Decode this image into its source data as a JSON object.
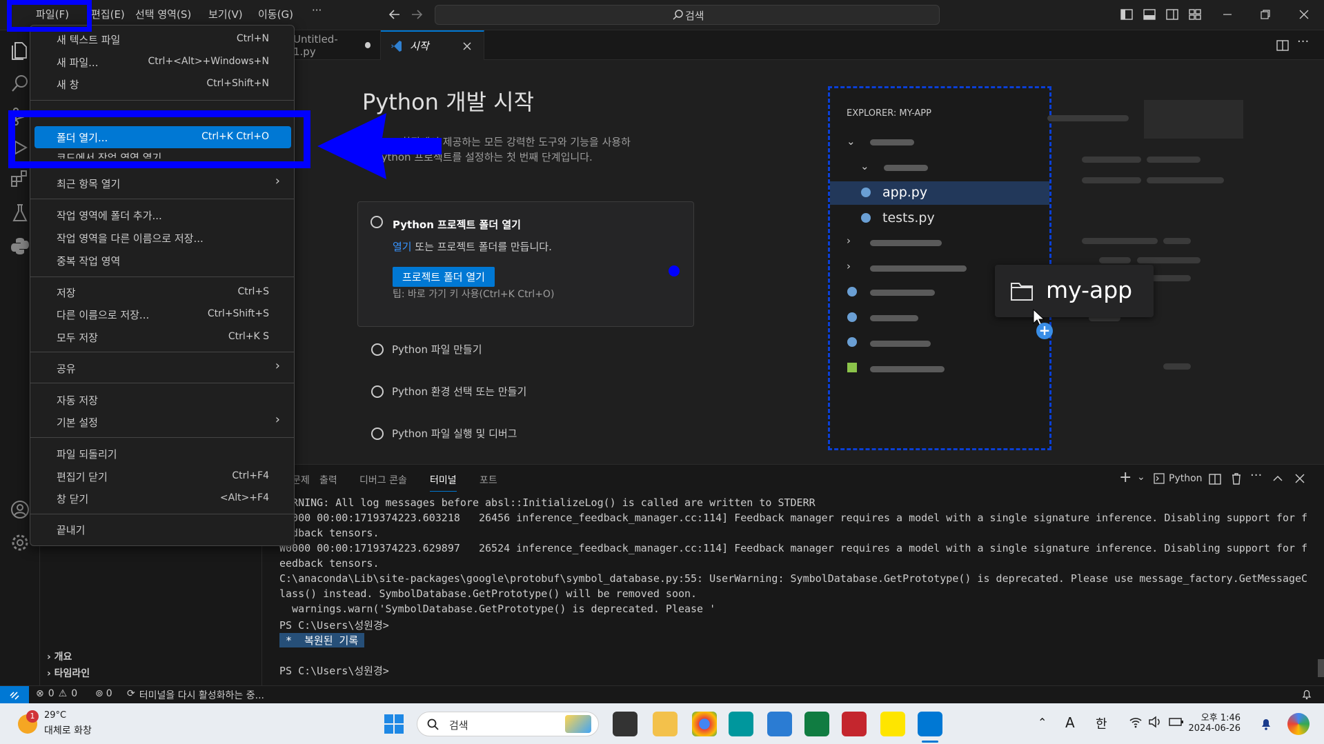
{
  "titlebar": {
    "menus": [
      "파일(F)",
      "편집(E)",
      "선택 영역(S)",
      "보기(V)",
      "이동(G)",
      "···"
    ],
    "search_placeholder": "검색"
  },
  "file_menu": {
    "items": [
      {
        "label": "새 텍스트 파일",
        "shortcut": "Ctrl+N"
      },
      {
        "label": "새 파일...",
        "shortcut": "Ctrl+<Alt>+Windows+N"
      },
      {
        "label": "새 창",
        "shortcut": "Ctrl+Shift+N"
      },
      {
        "label": "폴더 열기...",
        "shortcut": "Ctrl+K Ctrl+O"
      },
      {
        "label": "코드에서 작업 영역 열기...",
        "shortcut": ""
      },
      {
        "label": "최근 항목 열기",
        "shortcut": ""
      },
      {
        "label": "작업 영역에 폴더 추가...",
        "shortcut": ""
      },
      {
        "label": "작업 영역을 다른 이름으로 저장...",
        "shortcut": ""
      },
      {
        "label": "중복 작업 영역",
        "shortcut": ""
      },
      {
        "label": "저장",
        "shortcut": "Ctrl+S"
      },
      {
        "label": "다른 이름으로 저장...",
        "shortcut": "Ctrl+Shift+S"
      },
      {
        "label": "모두 저장",
        "shortcut": "Ctrl+K S"
      },
      {
        "label": "공유",
        "shortcut": ""
      },
      {
        "label": "자동 저장",
        "shortcut": ""
      },
      {
        "label": "기본 설정",
        "shortcut": ""
      },
      {
        "label": "파일 되돌리기",
        "shortcut": ""
      },
      {
        "label": "편집기 닫기",
        "shortcut": "Ctrl+F4"
      },
      {
        "label": "창 닫기",
        "shortcut": "<Alt>+F4"
      },
      {
        "label": "끝내기",
        "shortcut": ""
      }
    ]
  },
  "tabs": [
    {
      "label": "Untitled-1.py"
    },
    {
      "label": "시작"
    }
  ],
  "welcome": {
    "title": "Python 개발 시작",
    "desc_line1": "Python 확장에서 제공하는 모든 강력한 도구와 기능을 사용하",
    "desc_line2": "여 Python 프로젝트를 설정하는 첫 번째 단계입니다.",
    "step1_title": "Python 프로젝트 폴더 열기",
    "step1_link": "열기",
    "step1_desc": " 또는 프로젝트 폴더를 만듭니다.",
    "step1_button": "프로젝트 폴더 열기",
    "step1_tip": "팁: 바로 가기 키 사용(Ctrl+K Ctrl+O)",
    "step2": "Python 파일 만들기",
    "step3": "Python 환경 선택 또는 만들기",
    "step4": "Python 파일 실행 및 디버그"
  },
  "explorer_illustration": {
    "header": "EXPLORER: MY-APP",
    "file1": "app.py",
    "file2": "tests.py",
    "folder_tooltip": "my-app"
  },
  "panel": {
    "tabs": [
      "문제",
      "출력",
      "디버그 콘솔",
      "터미널",
      "포트"
    ],
    "active_tab": "터미널",
    "shell": "Python",
    "lines": [
      "WARNING: All log messages before absl::InitializeLog() is called are written to STDERR",
      "W0000 00:00:1719374223.603218   26456 inference_feedback_manager.cc:114] Feedback manager requires a model with a single signature inference. Disabling support for f",
      "eedback tensors.",
      "W0000 00:00:1719374223.629897   26524 inference_feedback_manager.cc:114] Feedback manager requires a model with a single signature inference. Disabling support for f",
      "eedback tensors.",
      "C:\\anaconda\\Lib\\site-packages\\google\\protobuf\\symbol_database.py:55: UserWarning: SymbolDatabase.GetPrototype() is deprecated. Please use message_factory.GetMessageC",
      "lass() instead. SymbolDatabase.GetPrototype() will be removed soon.",
      "  warnings.warn('SymbolDatabase.GetPrototype() is deprecated. Please '",
      "PS C:\\Users\\성원경>"
    ],
    "restored": " *  복원된 기록 ",
    "prompt_last": "PS C:\\Users\\성원경>"
  },
  "sidebar": {
    "outline": "개요",
    "timeline": "타임라인"
  },
  "statusbar": {
    "errors": "0",
    "warnings": "0",
    "ports": "0",
    "message": "터미널을 다시 활성화하는 중..."
  },
  "taskbar": {
    "weather_temp": "29°C",
    "weather_desc": "대체로 화창",
    "weather_badge": "1",
    "search": "검색",
    "lang1": "A",
    "lang2": "한",
    "time": "오후 1:46",
    "date": "2024-06-26"
  }
}
